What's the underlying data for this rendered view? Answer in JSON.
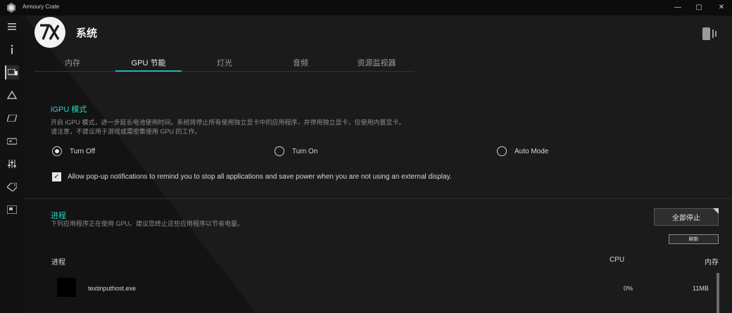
{
  "window": {
    "title": "Armoury Crate"
  },
  "header": {
    "title": "系统"
  },
  "tabs": [
    {
      "label": "内存"
    },
    {
      "label": "GPU 节能"
    },
    {
      "label": "灯光"
    },
    {
      "label": "音频"
    },
    {
      "label": "资源监视器"
    }
  ],
  "igpu": {
    "title": "iGPU 模式",
    "description_line1": "开启 iGPU 模式，进一步延长电池使用时间。系统将停止所有使用独立显卡中的应用程序，并停用独立显卡，仅使用内置显卡。",
    "description_line2": "请注意，不建议用于游戏或需密集使用 GPU 的工作。",
    "options": [
      {
        "label": "Turn Off",
        "selected": true
      },
      {
        "label": "Turn On",
        "selected": false
      },
      {
        "label": "Auto Mode",
        "selected": false
      }
    ],
    "notify_label": "Allow pop-up notifications to remind you to stop all applications and save power when you are not using an external display.",
    "notify_checked": true
  },
  "process": {
    "title": "进程",
    "description": "下列应用程序正在使用 GPU。建议您终止这些应用程序以节省电量。",
    "stop_all_label": "全部停止",
    "refresh_label": "刷新",
    "columns": {
      "name": "进程",
      "cpu": "CPU",
      "memory": "内存"
    },
    "rows": [
      {
        "name": "textinputhost.exe",
        "cpu": "0%",
        "memory": "11MB"
      }
    ]
  },
  "colors": {
    "accent": "#2fd2c6",
    "tab_underline": "#1fb8b0"
  }
}
